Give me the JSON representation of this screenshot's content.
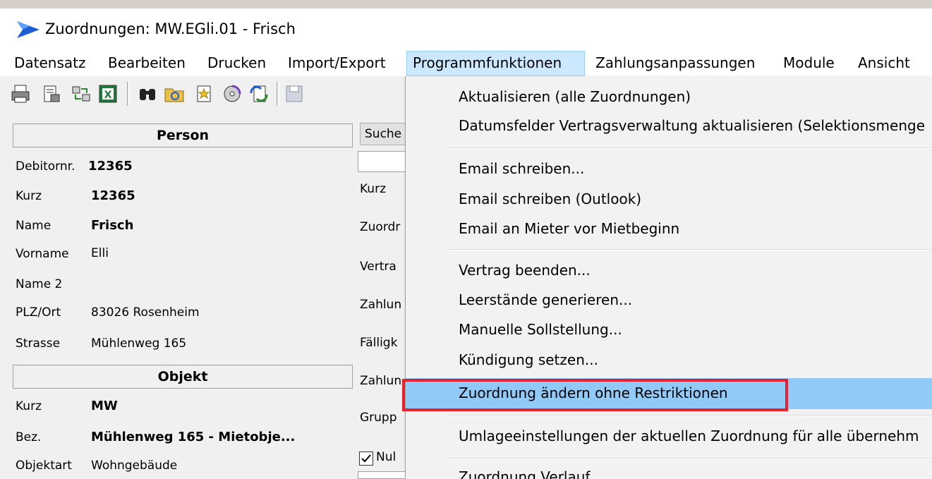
{
  "window": {
    "title": "Zuordnungen: MW.EGli.01 - Frisch"
  },
  "menubar": {
    "items": [
      "Datensatz",
      "Bearbeiten",
      "Drucken",
      "Import/Export",
      "Programmfunktionen",
      "Zahlungsanpassungen",
      "Module",
      "Ansicht"
    ],
    "active": "Programmfunktionen"
  },
  "person": {
    "header": "Person",
    "fields": [
      {
        "label": "Debitornr.",
        "value": "12365"
      },
      {
        "label": "Kurz",
        "value": "12365"
      },
      {
        "label": "Name",
        "value": "Frisch"
      },
      {
        "label": "Vorname",
        "value": "Elli"
      },
      {
        "label": "Name 2",
        "value": ""
      },
      {
        "label": "PLZ/Ort",
        "value": "83026 Rosenheim"
      },
      {
        "label": "Strasse",
        "value": "Mühlenweg 165"
      }
    ]
  },
  "objekt": {
    "header": "Objekt",
    "fields": [
      {
        "label": "Kurz",
        "value": "MW"
      },
      {
        "label": "Bez.",
        "value": "Mühlenweg 165 - Mietobje..."
      },
      {
        "label": "Objektart",
        "value": "Wohngebäude"
      }
    ]
  },
  "middle": {
    "search_button": "Suche",
    "labels": [
      "Kurz",
      "Zuordr",
      "Vertra",
      "Zahlun",
      "Fälligk",
      "Zahlun",
      "Grupp"
    ],
    "checkbox_label": "Nul",
    "checkbox_checked": true
  },
  "dropdown": {
    "items": [
      {
        "label": "Aktualisieren (alle Zuordnungen)"
      },
      {
        "label": "Datumsfelder Vertragsverwaltung aktualisieren (Selektionsmenge"
      },
      {
        "label": "Email schreiben..."
      },
      {
        "label": "Email schreiben (Outlook)"
      },
      {
        "label": "Email an Mieter vor Mietbeginn"
      },
      {
        "label": "Vertrag beenden..."
      },
      {
        "label": "Leerstände generieren..."
      },
      {
        "label": "Manuelle Sollstellung..."
      },
      {
        "label": "Kündigung setzen..."
      },
      {
        "label": "Zuordnung ändern ohne Restriktionen"
      },
      {
        "label": "Umlageeinstellungen der aktuellen Zuordnung für alle übernehm"
      },
      {
        "label": "Zuordnung Verlauf"
      }
    ],
    "highlighted": "Zuordnung ändern ohne Restriktionen",
    "highlight_color": "#e8212e",
    "hover_color": "#91c9f7"
  }
}
